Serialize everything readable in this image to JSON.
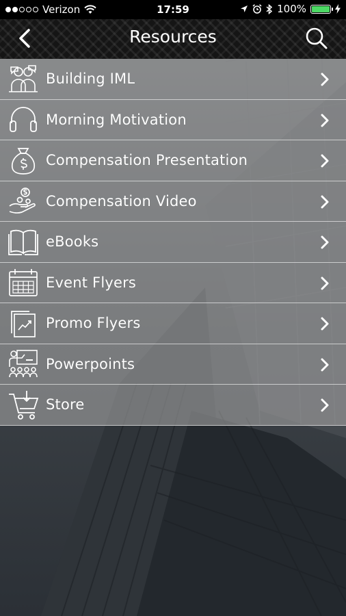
{
  "status_bar": {
    "carrier": "Verizon",
    "time": "17:59",
    "battery": "100%",
    "signal_bars": 2,
    "battery_level": 1.0
  },
  "nav": {
    "title": "Resources",
    "back_icon": "chevron-left-icon",
    "search_icon": "search-icon"
  },
  "menu": [
    {
      "label": "Building IML",
      "icon": "team-people-icon"
    },
    {
      "label": "Morning Motivation",
      "icon": "headphones-icon"
    },
    {
      "label": "Compensation Presentation",
      "icon": "money-bag-icon"
    },
    {
      "label": "Compensation Video",
      "icon": "hand-coins-icon"
    },
    {
      "label": "eBooks",
      "icon": "open-book-icon"
    },
    {
      "label": "Event Flyers",
      "icon": "calendar-icon"
    },
    {
      "label": "Promo Flyers",
      "icon": "flyer-chart-icon"
    },
    {
      "label": "Powerpoints",
      "icon": "presentation-audience-icon"
    },
    {
      "label": "Store",
      "icon": "shopping-cart-icon"
    }
  ],
  "colors": {
    "row_bg": "#a0a0a0",
    "battery_green": "#4cd964"
  }
}
